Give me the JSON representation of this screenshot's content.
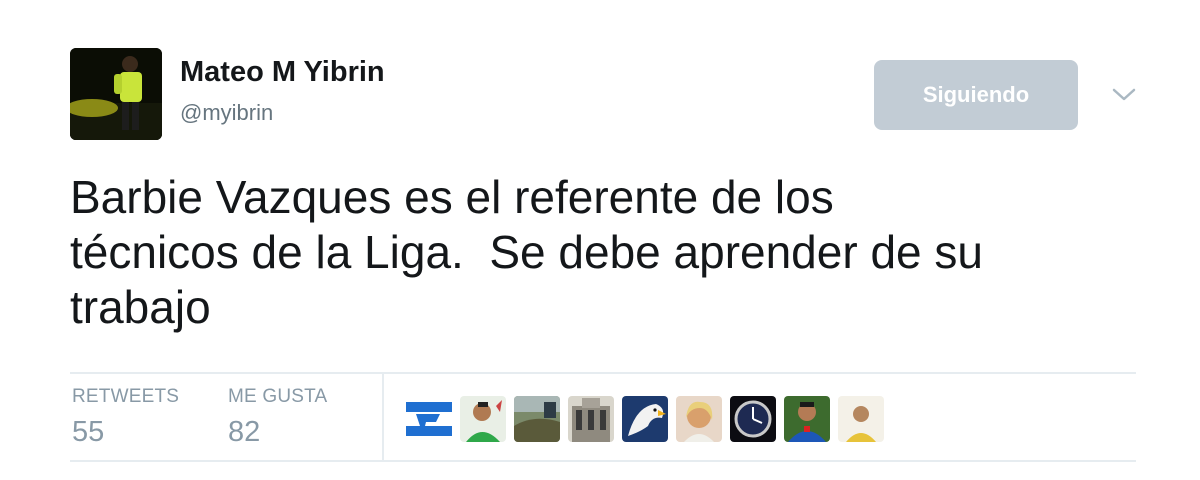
{
  "author": {
    "display_name": "Mateo M Yibrin",
    "handle": "@myibrin",
    "avatar_icon": "profile-photo-icon"
  },
  "follow_button": {
    "label": "Siguiendo"
  },
  "menu": {
    "icon": "chevron-down-icon"
  },
  "tweet": {
    "text": "Barbie Vazques es el referente de los\ntécnicos de la Liga.  Se debe aprender de su\ntrabajo"
  },
  "stats": {
    "retweets_label": "RETWEETS",
    "retweets_value": "55",
    "likes_label": "ME GUSTA",
    "likes_value": "82"
  },
  "likers": [
    {
      "icon": "honduras-flag-avatar-icon"
    },
    {
      "icon": "man-portrait-avatar-icon"
    },
    {
      "icon": "landscape-avatar-icon"
    },
    {
      "icon": "building-avatar-icon"
    },
    {
      "icon": "eagle-avatar-icon"
    },
    {
      "icon": "woman-portrait-avatar-icon"
    },
    {
      "icon": "watch-avatar-icon"
    },
    {
      "icon": "man-blue-shirt-avatar-icon"
    },
    {
      "icon": "man-small-avatar-icon"
    }
  ],
  "colors": {
    "follow_button_bg": "#c2ccd5",
    "text_primary": "#14171a",
    "text_secondary": "#66757f",
    "stat_gray": "#8899a6",
    "divider": "#e6ecf0"
  }
}
